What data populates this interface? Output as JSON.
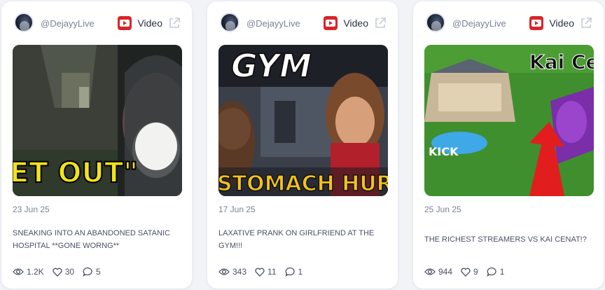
{
  "cards": [
    {
      "handle": "@DejayyLive",
      "type_label": "Video",
      "thumb_text": "ET OUT\"",
      "date": "23 Jun 25",
      "title": "SNEAKING INTO AN ABANDONED SATANIC HOSPITAL **GONE WORNG**",
      "views": "1.2K",
      "likes": "30",
      "comments": "5"
    },
    {
      "handle": "@DejayyLive",
      "type_label": "Video",
      "thumb_text_top": "GYM",
      "thumb_text_bottom": "STOMACH HURT",
      "date": "17 Jun 25",
      "title": "LAXATIVE PRANK ON GIRLFRIEND AT THE GYM!!!",
      "views": "343",
      "likes": "11",
      "comments": "1"
    },
    {
      "handle": "@DejayyLive",
      "type_label": "Video",
      "thumb_text_top": "Kai Ce",
      "thumb_text_side": "KICK",
      "date": "25 Jun 25",
      "title": "THE RICHEST STREAMERS VS KAI CENAT!?",
      "views": "944",
      "likes": "9",
      "comments": "1"
    }
  ],
  "icons": {
    "platform": "youtube-icon",
    "external": "external-link-icon",
    "views": "eye-icon",
    "likes": "heart-icon",
    "comments": "comment-icon"
  },
  "colors": {
    "youtube_red": "#d9252a",
    "background": "#f1f3f7",
    "text_muted": "#7a8295"
  }
}
